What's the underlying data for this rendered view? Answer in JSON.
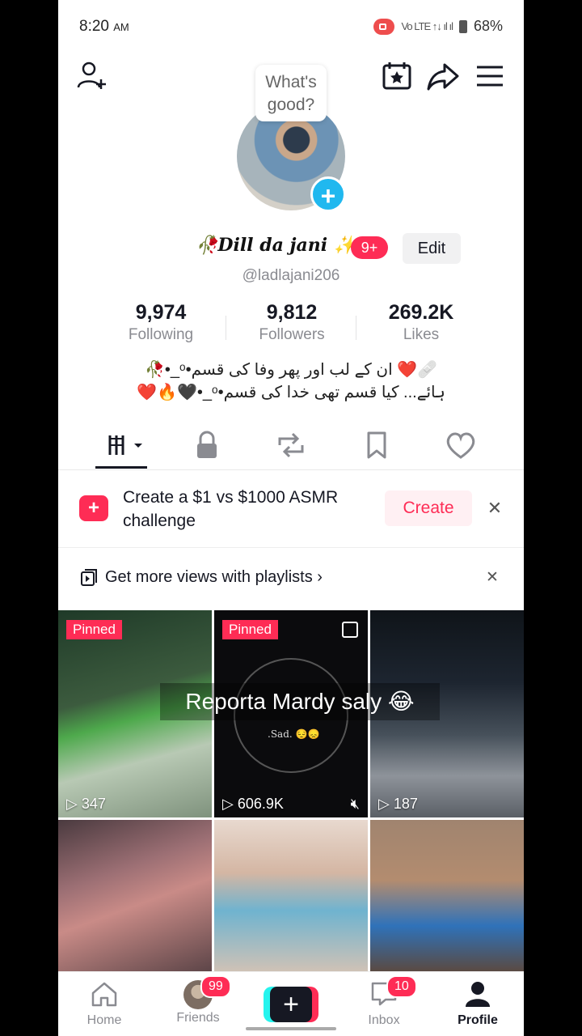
{
  "status_bar": {
    "time": "8:20",
    "ampm": "AM",
    "network": "Vo LTE ↑↓ ıl ıl",
    "battery": "68%"
  },
  "header": {
    "bubble_text": "What's good?"
  },
  "profile": {
    "display_name": "🥀Dill da jani ✨",
    "notif_badge": "9+",
    "edit_label": "Edit",
    "handle": "@ladlajani206"
  },
  "stats": [
    {
      "value": "9,974",
      "label": "Following"
    },
    {
      "value": "9,812",
      "label": "Followers"
    },
    {
      "value": "269.2K",
      "label": "Likes"
    }
  ],
  "bio": {
    "line1": "🩹❤️ ان کے لب اور پھر وفا کی قسم•ᵒ_•🥀",
    "line2": "ہائے... کیا قسم تھی خدا کی قسم•ᵒ_•🖤🔥❤️"
  },
  "promo": {
    "text": "Create a $1 vs $1000 ASMR challenge",
    "button": "Create"
  },
  "playlist": {
    "text": "Get more views with playlists ›"
  },
  "videos": [
    {
      "pinned": "Pinned",
      "views": "347"
    },
    {
      "pinned": "Pinned",
      "views": "606.9K",
      "overlay": ".Sad. 😔😞"
    },
    {
      "views": "187"
    },
    {
      "views": ""
    },
    {
      "views": ""
    },
    {
      "views": ""
    }
  ],
  "video_caption": "Reporta Mardy saly 😂",
  "nav": {
    "home": "Home",
    "friends": "Friends",
    "friends_badge": "99",
    "create": "+",
    "inbox": "Inbox",
    "inbox_badge": "10",
    "profile": "Profile"
  },
  "colors": {
    "accent": "#fe2c55",
    "cyan": "#25f4ee",
    "text": "#161823",
    "muted": "#8a8b91"
  }
}
